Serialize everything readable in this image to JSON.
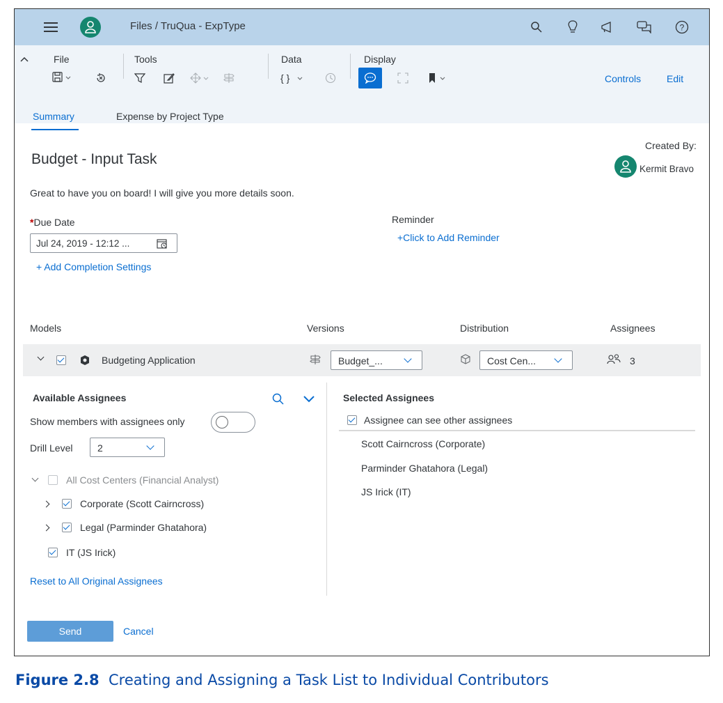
{
  "shell": {
    "breadcrumb": "Files  /  TruQua - ExpType",
    "icons": [
      "menu-icon",
      "avatar-icon",
      "search-icon",
      "lightbulb-icon",
      "megaphone-icon",
      "chat-icon",
      "help-icon"
    ]
  },
  "toolbar": {
    "groups": {
      "file": "File",
      "tools": "Tools",
      "data": "Data",
      "display": "Display"
    },
    "controls": "Controls",
    "edit": "Edit"
  },
  "tabs": {
    "summary": "Summary",
    "expense": "Expense by Project Type"
  },
  "task": {
    "title": "Budget - Input Task",
    "created_by_label": "Created By:",
    "created_by_name": "Kermit Bravo",
    "message": "Great to have you on board! I will give you more details soon.",
    "due_date_asterisk": "*",
    "due_date_label": "Due Date",
    "due_date_value": "Jul 24, 2019 - 12:12 ...",
    "reminder_label": "Reminder",
    "add_reminder": "+Click to Add Reminder",
    "add_completion": "+ Add Completion Settings"
  },
  "models": {
    "headers": {
      "models": "Models",
      "versions": "Versions",
      "distribution": "Distribution",
      "assignees": "Assignees"
    },
    "row": {
      "name": "Budgeting Application",
      "version": "Budget_...",
      "distribution": "Cost Cen...",
      "assignee_count": "3"
    }
  },
  "available": {
    "title": "Available Assignees",
    "show_members_label": "Show members with assignees only",
    "drill_label": "Drill Level",
    "drill_value": "2",
    "tree": {
      "root": "All Cost Centers (Financial Analyst)",
      "corporate": "Corporate (Scott Cairncross)",
      "legal": "Legal (Parminder Ghatahora)",
      "it": "IT (JS Irick)"
    },
    "reset": "Reset to All Original Assignees"
  },
  "selected": {
    "title": "Selected Assignees",
    "can_see_label": "Assignee can see other assignees",
    "items": [
      "Scott Cairncross (Corporate)",
      "Parminder Ghatahora (Legal)",
      "JS Irick (IT)"
    ]
  },
  "footer": {
    "send": "Send",
    "cancel": "Cancel"
  },
  "caption": {
    "number": "Figure 2.8",
    "text": "Creating and Assigning a Task List to Individual Contributors"
  },
  "colors": {
    "accent": "#0a6ed1",
    "shell": "#b9d3ea",
    "avatar": "#15866f",
    "send_button": "#5d9dd8",
    "caption": "#0a4aa6"
  }
}
